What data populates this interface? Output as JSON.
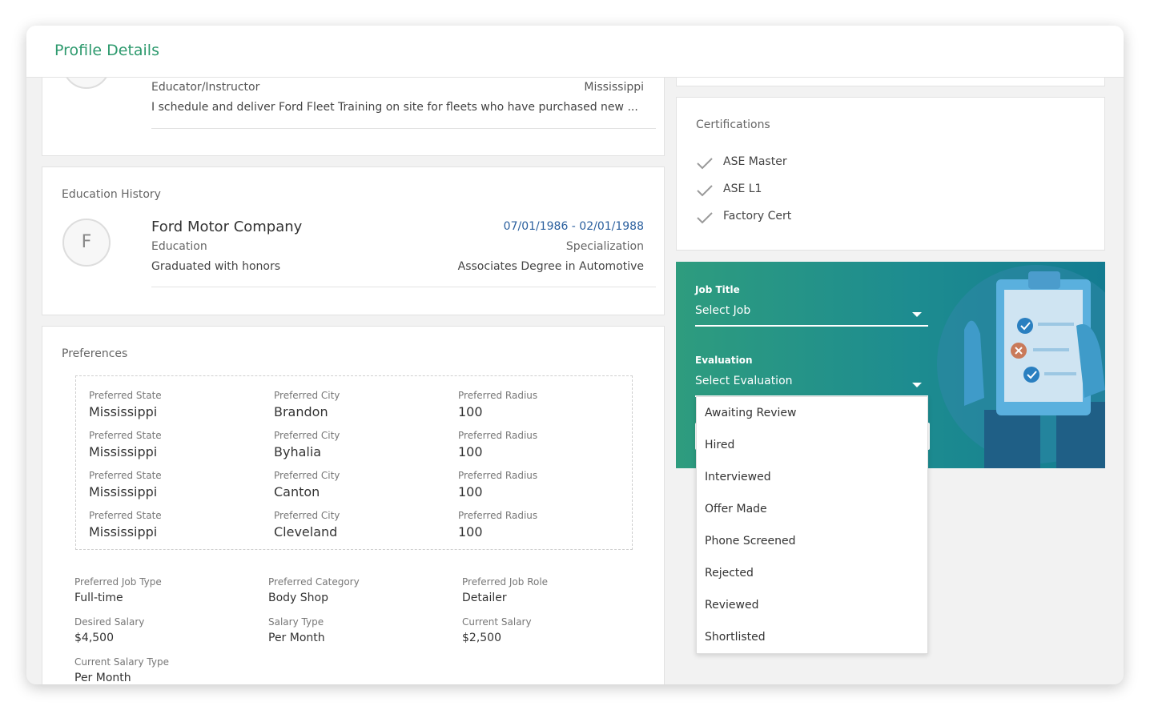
{
  "modal": {
    "title": "Profile Details"
  },
  "experience": {
    "role": "Educator/Instructor",
    "location": "Mississippi",
    "description": "I schedule and deliver Ford Fleet Training on site for fleets who have purchased new ..."
  },
  "education": {
    "section_title": "Education History",
    "avatar_letter": "F",
    "institution": "Ford Motor Company",
    "dates": "07/01/1986 - 02/01/1988",
    "type": "Education",
    "specialization_label": "Specialization",
    "note": "Graduated with honors",
    "specialization": "Associates Degree in Automotive"
  },
  "preferences": {
    "section_title": "Preferences",
    "locations": [
      {
        "state_label": "Preferred State",
        "state": "Mississippi",
        "city_label": "Preferred City",
        "city": "Brandon",
        "radius_label": "Preferred Radius",
        "radius": "100"
      },
      {
        "state_label": "Preferred State",
        "state": "Mississippi",
        "city_label": "Preferred City",
        "city": "Byhalia",
        "radius_label": "Preferred Radius",
        "radius": "100"
      },
      {
        "state_label": "Preferred State",
        "state": "Mississippi",
        "city_label": "Preferred City",
        "city": "Canton",
        "radius_label": "Preferred Radius",
        "radius": "100"
      },
      {
        "state_label": "Preferred State",
        "state": "Mississippi",
        "city_label": "Preferred City",
        "city": "Cleveland",
        "radius_label": "Preferred Radius",
        "radius": "100"
      }
    ],
    "other": [
      {
        "label": "Preferred Job Type",
        "value": "Full-time"
      },
      {
        "label": "Preferred Category",
        "value": "Body Shop"
      },
      {
        "label": "Preferred Job Role",
        "value": "Detailer"
      },
      {
        "label": "Desired Salary",
        "value": "$4,500"
      },
      {
        "label": "Salary Type",
        "value": "Per Month"
      },
      {
        "label": "Current Salary",
        "value": "$2,500"
      },
      {
        "label": "Current Salary Type",
        "value": "Per Month"
      }
    ]
  },
  "certifications": {
    "section_title": "Certifications",
    "items": [
      "ASE Master",
      "ASE L1",
      "Factory Cert"
    ]
  },
  "evaluation_panel": {
    "job_title_label": "Job Title",
    "job_select_value": "Select Job",
    "evaluation_label": "Evaluation",
    "evaluation_select_value": "Select Evaluation",
    "options": [
      "Awaiting Review",
      "Hired",
      "Interviewed",
      "Offer Made",
      "Phone Screened",
      "Rejected",
      "Reviewed",
      "Shortlisted"
    ]
  },
  "colors": {
    "title_green": "#2e9a6e",
    "date_blue": "#2a5f9e",
    "panel_gradient_start": "#2e9c7e",
    "panel_gradient_end": "#137c91"
  }
}
